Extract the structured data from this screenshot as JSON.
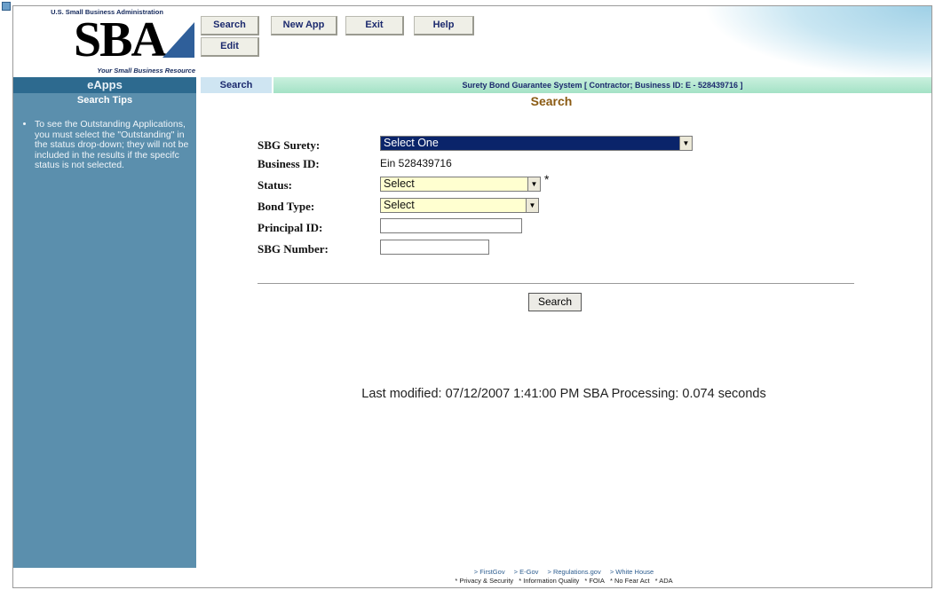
{
  "header": {
    "org_line": "U.S. Small Business Administration",
    "logo_letters": "SBA",
    "tagline": "Your Small Business Resource"
  },
  "toolbar": {
    "search": "Search",
    "new_app": "New App",
    "exit": "Exit",
    "help": "Help",
    "edit": "Edit"
  },
  "nav": {
    "app_name": "eApps",
    "current_tab": "Search",
    "status": "Surety Bond Guarantee System   [ Contractor;  Business ID: E - 528439716 ]"
  },
  "sidebar": {
    "title": "Search Tips",
    "tip": "To see the Outstanding Applications, you must select the \"Outstanding\" in the status drop-down; they will not be included in the results if the specifc status is not selected."
  },
  "main": {
    "title": "Search",
    "form": {
      "surety_label": "SBG Surety:",
      "surety_value": "Select One",
      "business_id_label": "Business ID:",
      "business_id_value": "Ein 528439716",
      "status_label": "Status:",
      "status_value": "Select",
      "bond_type_label": "Bond Type:",
      "bond_type_value": "Select",
      "principal_id_label": "Principal ID:",
      "principal_id_value": "",
      "sbg_number_label": "SBG Number:",
      "sbg_number_value": "",
      "required_mark": "*",
      "search_button": "Search"
    },
    "last_modified": "Last modified: 07/12/2007 1:41:00 PM   SBA Processing:  0.074 seconds"
  },
  "footer": {
    "links": [
      "> FirstGov",
      "> E-Gov",
      "> Regulations.gov",
      "> White House"
    ],
    "sub_links": [
      "* Privacy & Security",
      "* Information Quality",
      "* FOIA",
      "* No Fear Act",
      "* ADA"
    ]
  },
  "colors": {
    "sidebar": "#5b8fad",
    "eapps_bar": "#2d6a8f",
    "status_bar": "#a4e2c6",
    "selected_dropdown": "#0a246a",
    "dropdown_fill": "#ffffd0",
    "title_text": "#8a5a12"
  },
  "icons": {
    "corner": "page-icon",
    "dropdown": "chevron-down-icon"
  }
}
